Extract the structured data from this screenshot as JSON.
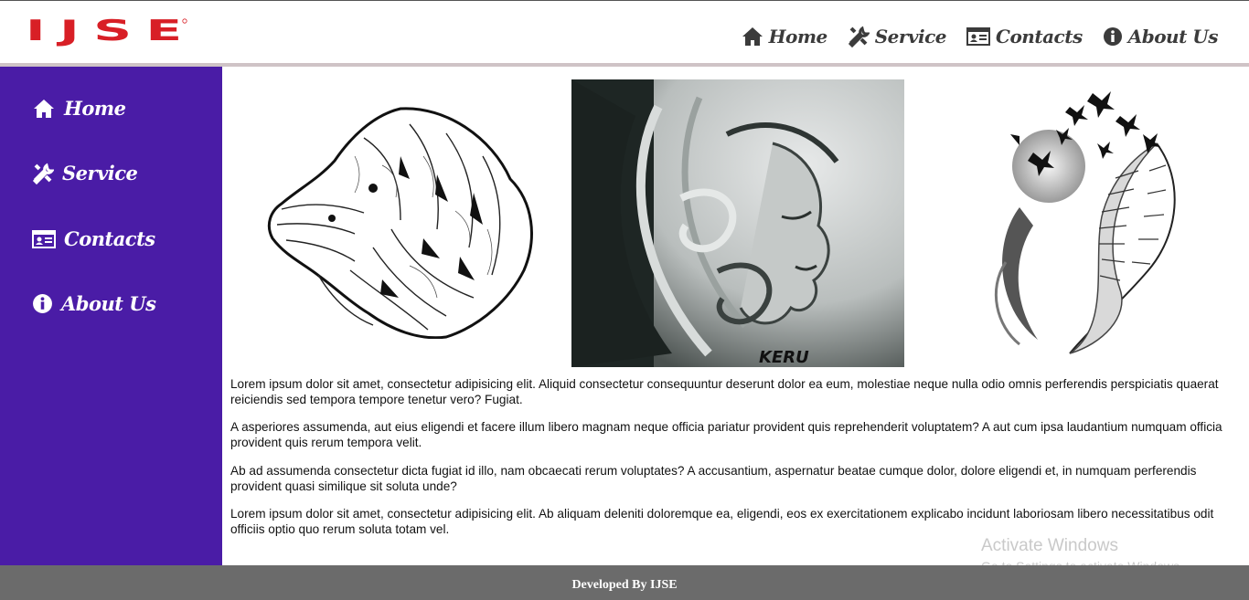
{
  "brand": {
    "logo_text": "IJSE",
    "colors": {
      "logo": "#d81f26",
      "sidebar": "#4a1ca6",
      "footer": "#6b6b6b"
    }
  },
  "header": {
    "nav": [
      {
        "label": "Home",
        "icon": "home-icon"
      },
      {
        "label": "Service",
        "icon": "tools-icon"
      },
      {
        "label": "Contacts",
        "icon": "contact-card-icon"
      },
      {
        "label": "About Us",
        "icon": "info-icon"
      }
    ]
  },
  "sidebar": {
    "items": [
      {
        "label": "Home",
        "icon": "home-icon"
      },
      {
        "label": "Service",
        "icon": "tools-icon"
      },
      {
        "label": "Contacts",
        "icon": "contact-card-icon"
      },
      {
        "label": "About Us",
        "icon": "info-icon"
      }
    ]
  },
  "gallery": {
    "images": [
      {
        "name": "lion-mandala-image"
      },
      {
        "name": "ornamental-face-image",
        "caption": "KERU"
      },
      {
        "name": "feather-birds-image"
      }
    ]
  },
  "content": {
    "paragraphs": [
      "Lorem ipsum dolor sit amet, consectetur adipisicing elit. Aliquid consectetur consequuntur deserunt dolor ea eum, molestiae neque nulla odio omnis perferendis perspiciatis quaerat reiciendis sed tempora tempore tenetur vero? Fugiat.",
      "A asperiores assumenda, aut eius eligendi et facere illum libero magnam neque officia pariatur provident quis reprehenderit voluptatem? A aut cum ipsa laudantium numquam officia provident quis rerum tempora velit.",
      "Ab ad assumenda consectetur dicta fugiat id illo, nam obcaecati rerum voluptates? A accusantium, aspernatur beatae cumque dolor, dolore eligendi et, in numquam perferendis provident quasi similique sit soluta unde?",
      "Lorem ipsum dolor sit amet, consectetur adipisicing elit. Ab aliquam deleniti doloremque ea, eligendi, eos ex exercitationem explicabo incidunt laboriosam libero necessitatibus odit officiis optio quo rerum soluta totam vel."
    ]
  },
  "footer": {
    "text": "Developed By IJSE"
  },
  "watermark": {
    "line1": "Activate Windows",
    "line2": "Go to Settings to activate Windows."
  }
}
